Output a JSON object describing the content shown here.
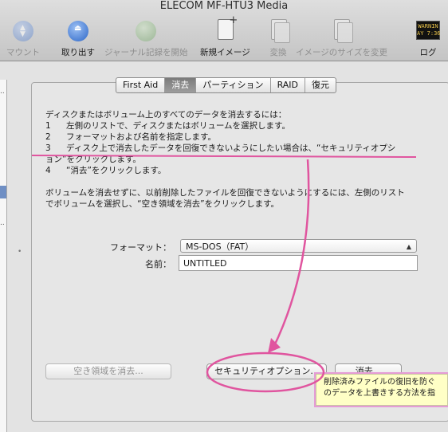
{
  "window": {
    "title": "ELECOM MF-HTU3 Media"
  },
  "toolbar": {
    "items": [
      {
        "label": "マウント",
        "icon": "mount-icon",
        "enabled": false
      },
      {
        "label": "取り出す",
        "icon": "eject-icon",
        "enabled": true
      },
      {
        "label": "ジャーナル記録を開始",
        "icon": "journal-icon",
        "enabled": false
      },
      {
        "label": "新規イメージ",
        "icon": "new-image-icon",
        "enabled": true
      },
      {
        "label": "変換",
        "icon": "convert-icon",
        "enabled": false
      },
      {
        "label": "イメージのサイズを変更",
        "icon": "resize-image-icon",
        "enabled": false
      },
      {
        "label": "ログ",
        "icon": "log-icon",
        "enabled": true,
        "badge": "WARNIN\nAY 7:36"
      }
    ]
  },
  "tabs": [
    {
      "label": "First Aid",
      "active": false
    },
    {
      "label": "消去",
      "active": true
    },
    {
      "label": "パーティション",
      "active": false
    },
    {
      "label": "RAID",
      "active": false
    },
    {
      "label": "復元",
      "active": false
    }
  ],
  "instructions": {
    "intro": "ディスクまたはボリューム上のすべてのデータを消去するには：",
    "steps": [
      {
        "num": "1",
        "text": "左側のリストで、ディスクまたはボリュームを選択します。"
      },
      {
        "num": "2",
        "text": "フォーマットおよび名前を指定します。"
      },
      {
        "num": "3",
        "text": "ディスク上で消去したデータを回復できないようにしたい場合は、“セキュリティオプション”をクリックします。",
        "line1": "ディスク上で消去したデータを回復できないようにしたい場合は、“セキュリティオプシ",
        "line2": "ョン”をクリックします。"
      },
      {
        "num": "4",
        "text": "“消去”をクリックします。"
      }
    ],
    "note_line1": "ボリュームを消去せずに、以前削除したファイルを回復できないようにするには、左側のリスト",
    "note_line2": "でボリュームを選択し、“空き領域を消去”をクリックします。"
  },
  "form": {
    "format_label": "フォーマット：",
    "format_value": "MS-DOS（FAT）",
    "name_label": "名前：",
    "name_value": "UNTITLED"
  },
  "buttons": {
    "erase_free_space": "空き領域を消去...",
    "security_options": "セキュリティオプション...",
    "erase": "消去..."
  },
  "tooltip": {
    "line1": "削除済みファイルの復旧を防ぐ",
    "line2": "のデータを上書きする方法を指"
  },
  "annotation": {
    "color": "#e0559f"
  }
}
